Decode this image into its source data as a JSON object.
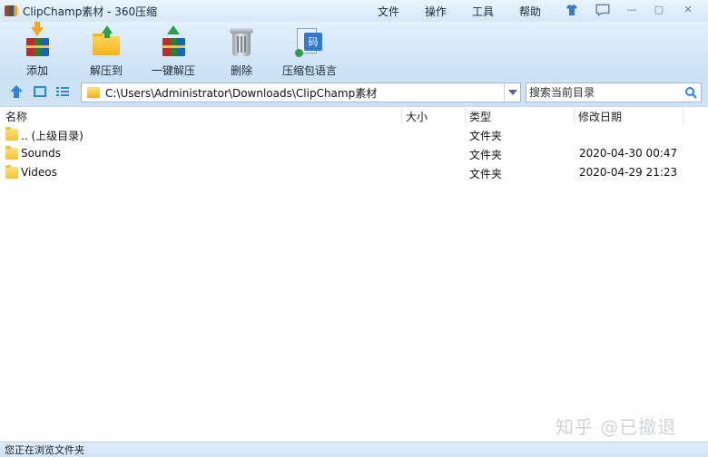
{
  "window": {
    "title": "ClipChamp素材 - 360压缩",
    "menu": [
      "文件",
      "操作",
      "工具",
      "帮助"
    ],
    "controls": {
      "skin": "shirt-icon",
      "feedback": "message-icon",
      "minimize": "—",
      "maximize": "▢",
      "close": "✕"
    }
  },
  "toolbar": {
    "items": [
      {
        "label": "添加",
        "icon": "add-archive-icon"
      },
      {
        "label": "解压到",
        "icon": "extract-to-icon"
      },
      {
        "label": "一键解压",
        "icon": "one-click-extract-icon"
      },
      {
        "label": "删除",
        "icon": "trash-icon"
      },
      {
        "label": "压缩包语言",
        "icon": "archive-language-icon"
      }
    ],
    "language_badge": "码"
  },
  "address": {
    "path": "C:\\Users\\Administrator\\Downloads\\ClipChamp素材"
  },
  "search": {
    "placeholder": "搜索当前目录"
  },
  "columns": {
    "name": "名称",
    "size": "大小",
    "type": "类型",
    "modified": "修改日期"
  },
  "rows": [
    {
      "name": ".. (上级目录)",
      "size": "",
      "type": "文件夹",
      "modified": ""
    },
    {
      "name": "Sounds",
      "size": "",
      "type": "文件夹",
      "modified": "2020-04-30 00:47"
    },
    {
      "name": "Videos",
      "size": "",
      "type": "文件夹",
      "modified": "2020-04-29 21:23"
    }
  ],
  "watermark": "知乎 @已撤退",
  "status": "您正在浏览文件夹",
  "colors": {
    "accent": "#2f7ad0",
    "folder": "#f3c236",
    "chrome": "#cfe3f7"
  }
}
